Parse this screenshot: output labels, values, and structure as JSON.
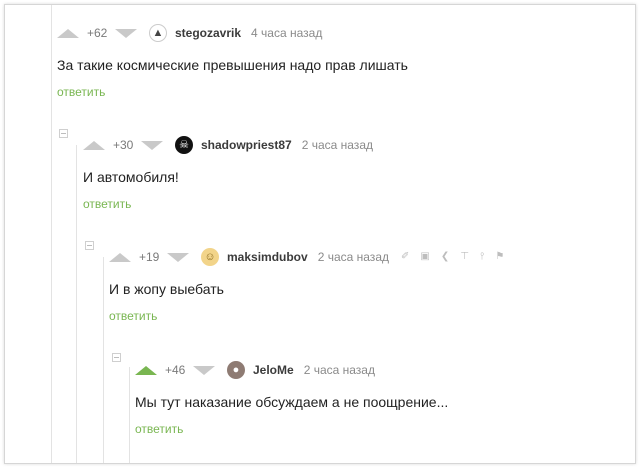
{
  "comments": [
    {
      "rating": "+62",
      "username": "stegozavrik",
      "time": "4 часа назад",
      "text": "За такие космические превышения надо прав лишать",
      "reply": "ответить",
      "avatar_icon": "dino-avatar"
    },
    {
      "rating": "+30",
      "username": "shadowpriest87",
      "time": "2 часа назад",
      "text": "И автомобиля!",
      "reply": "ответить",
      "avatar_icon": "skull-avatar"
    },
    {
      "rating": "+19",
      "username": "maksimdubov",
      "time": "2 часа назад",
      "text": "И в жопу выебать",
      "reply": "ответить",
      "avatar_icon": "face-avatar",
      "tools": [
        "link-icon",
        "save-icon",
        "share-icon",
        "pin-top-icon",
        "branch-icon",
        "flag-icon"
      ]
    },
    {
      "rating": "+46",
      "username": "JeloMe",
      "time": "2 часа назад",
      "text": "Мы тут наказание обсуждаем а не поощрение...",
      "reply": "ответить",
      "avatar_icon": "photo-avatar",
      "upvoted": true
    }
  ],
  "colors": {
    "accent": "#79b651",
    "muted": "#c9c9c9"
  }
}
